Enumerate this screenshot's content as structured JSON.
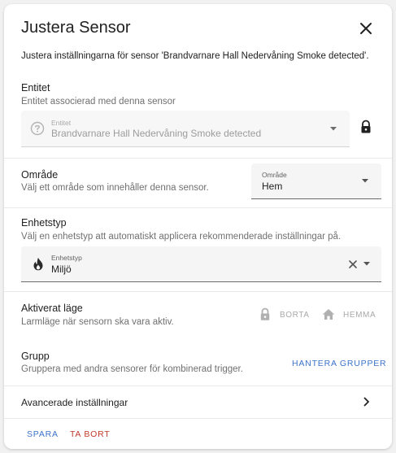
{
  "dialog": {
    "title": "Justera Sensor",
    "description": "Justera inställningarna för sensor 'Brandvarnare Hall Nedervåning Smoke detected'."
  },
  "entity": {
    "title": "Entitet",
    "subtitle": "Entitet associerad med denna sensor",
    "field_label": "Entitet",
    "field_value": "Brandvarnare Hall Nedervåning Smoke detected"
  },
  "area": {
    "title": "Område",
    "subtitle": "Välj ett område som innehåller denna sensor.",
    "field_label": "Område",
    "field_value": "Hem"
  },
  "device_type": {
    "title": "Enhetstyp",
    "subtitle": "Välj en enhetstyp att automatiskt applicera rekommenderade inställningar på.",
    "field_label": "Enhetstyp",
    "field_value": "Miljö"
  },
  "modes": {
    "title": "Aktiverat läge",
    "subtitle": "Larmläge när sensorn ska vara aktiv.",
    "away_label": "BORTA",
    "home_label": "HEMMA"
  },
  "group": {
    "title": "Grupp",
    "subtitle": "Gruppera med andra sensorer för kombinerad trigger.",
    "manage_label": "HANTERA GRUPPER"
  },
  "advanced": {
    "label": "Avancerade inställningar"
  },
  "footer": {
    "save_label": "SPARA",
    "delete_label": "TA BORT"
  },
  "colors": {
    "primary": "#3b73c8",
    "danger": "#c0392b",
    "disabled": "#a9a9a9"
  },
  "icons": {
    "close": "close-icon",
    "help": "help-circle-icon",
    "lock": "lock-icon",
    "fire": "fire-icon",
    "clear": "clear-icon",
    "dropdown": "chevron-down-icon",
    "chevron_right": "chevron-right-icon"
  }
}
